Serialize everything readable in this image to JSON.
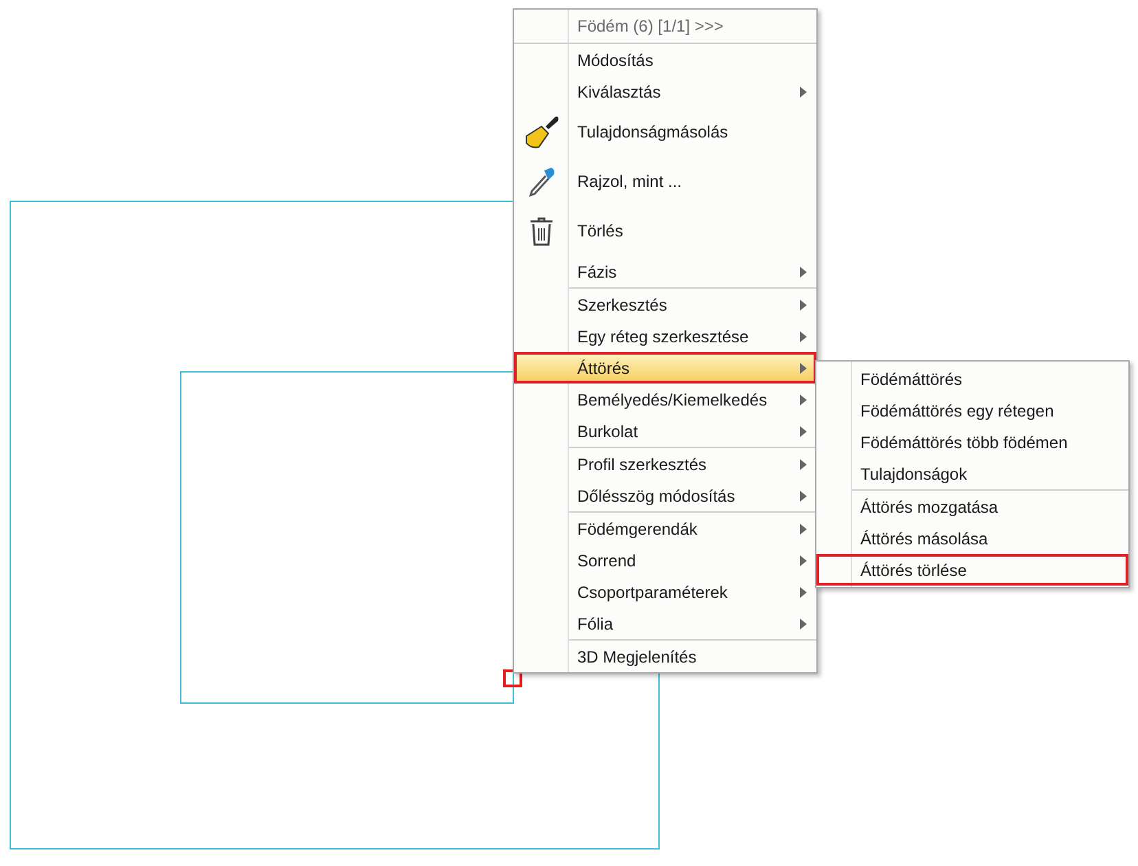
{
  "context_menu": {
    "header": "Födém (6) [1/1] >>>",
    "sections": [
      {
        "items": [
          {
            "label": "Módosítás",
            "kind": "plain",
            "submenu": false,
            "selected": false,
            "outlined": false
          },
          {
            "label": "Kiválasztás",
            "kind": "plain",
            "submenu": true,
            "selected": false,
            "outlined": false
          },
          {
            "label": "Tulajdonságmásolás",
            "kind": "brush",
            "submenu": false,
            "selected": false,
            "outlined": false
          },
          {
            "label": "Rajzol, mint ...",
            "kind": "dropper",
            "submenu": false,
            "selected": false,
            "outlined": false
          },
          {
            "label": "Törlés",
            "kind": "trash",
            "submenu": false,
            "selected": false,
            "outlined": false
          },
          {
            "label": "Fázis",
            "kind": "plain",
            "submenu": true,
            "selected": false,
            "outlined": false
          }
        ]
      },
      {
        "items": [
          {
            "label": "Szerkesztés",
            "kind": "plain",
            "submenu": true,
            "selected": false,
            "outlined": false
          },
          {
            "label": "Egy réteg szerkesztése",
            "kind": "plain",
            "submenu": true,
            "selected": false,
            "outlined": false
          },
          {
            "label": "Áttörés",
            "kind": "plain",
            "submenu": true,
            "selected": true,
            "outlined": true
          },
          {
            "label": "Bemélyedés/Kiemelkedés",
            "kind": "plain",
            "submenu": true,
            "selected": false,
            "outlined": false
          },
          {
            "label": "Burkolat",
            "kind": "plain",
            "submenu": true,
            "selected": false,
            "outlined": false
          }
        ]
      },
      {
        "items": [
          {
            "label": "Profil szerkesztés",
            "kind": "plain",
            "submenu": true,
            "selected": false,
            "outlined": false
          },
          {
            "label": "Dőlésszög módosítás",
            "kind": "plain",
            "submenu": true,
            "selected": false,
            "outlined": false
          }
        ]
      },
      {
        "items": [
          {
            "label": "Födémgerendák",
            "kind": "plain",
            "submenu": true,
            "selected": false,
            "outlined": false
          },
          {
            "label": "Sorrend",
            "kind": "plain",
            "submenu": true,
            "selected": false,
            "outlined": false
          },
          {
            "label": "Csoportparaméterek",
            "kind": "plain",
            "submenu": true,
            "selected": false,
            "outlined": false
          },
          {
            "label": "Fólia",
            "kind": "plain",
            "submenu": true,
            "selected": false,
            "outlined": false
          }
        ]
      },
      {
        "items": [
          {
            "label": "3D Megjelenítés",
            "kind": "plain",
            "submenu": false,
            "selected": false,
            "outlined": false
          }
        ]
      }
    ]
  },
  "submenu": {
    "sections": [
      {
        "items": [
          {
            "label": "Födémáttörés",
            "outlined": false
          },
          {
            "label": "Födémáttörés egy rétegen",
            "outlined": false
          },
          {
            "label": "Födémáttörés több födémen",
            "outlined": false
          },
          {
            "label": "Tulajdonságok",
            "outlined": false
          }
        ]
      },
      {
        "items": [
          {
            "label": "Áttörés mozgatása",
            "outlined": false
          },
          {
            "label": "Áttörés másolása",
            "outlined": false
          },
          {
            "label": "Áttörés törlése",
            "outlined": true
          }
        ]
      }
    ]
  }
}
